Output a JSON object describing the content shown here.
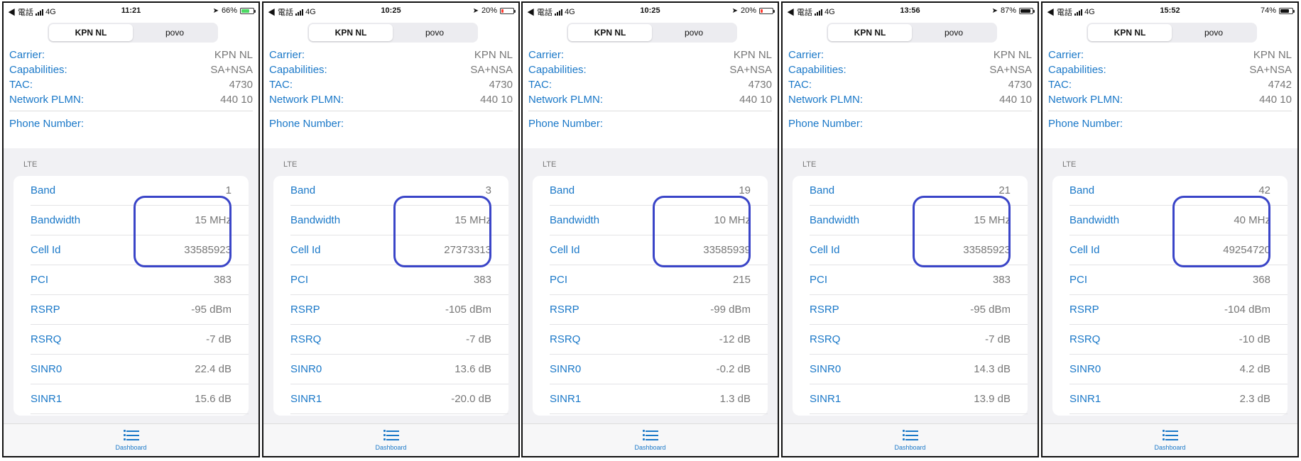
{
  "common": {
    "status_left": "◀ 電話",
    "network": "4G",
    "segments": [
      "KPN NL",
      "povo"
    ],
    "labels": {
      "carrier": "Carrier:",
      "capabilities": "Capabilities:",
      "tac": "TAC:",
      "plmn": "Network PLMN:",
      "phone": "Phone Number:",
      "section": "LTE",
      "band": "Band",
      "bandwidth": "Bandwidth",
      "cell_id": "Cell Id",
      "pci": "PCI",
      "rsrp": "RSRP",
      "rsrq": "RSRQ",
      "sinr0": "SINR0",
      "sinr1": "SINR1"
    },
    "tab_label": "Dashboard",
    "tab_icon": "list-icon",
    "accent": "#1a78c8",
    "highlight_color": "#3a45c8"
  },
  "phones": [
    {
      "time": "11:21",
      "location": true,
      "battery_text": "66%",
      "battery_level": 0.66,
      "battery_color": "#4cd964",
      "charging": true,
      "carrier": "KPN NL",
      "capabilities": "SA+NSA",
      "tac": "4730",
      "plmn": "440 10",
      "band": "1",
      "bandwidth": "15 MHz",
      "cell_id": "33585923",
      "pci": "383",
      "rsrp": "-95 dBm",
      "rsrq": "-7 dB",
      "sinr0": "22.4 dB",
      "sinr1": "15.6 dB"
    },
    {
      "time": "10:25",
      "location": true,
      "battery_text": "20%",
      "battery_level": 0.2,
      "battery_color": "#ff3b30",
      "charging": false,
      "carrier": "KPN NL",
      "capabilities": "SA+NSA",
      "tac": "4730",
      "plmn": "440 10",
      "band": "3",
      "bandwidth": "15 MHz",
      "cell_id": "27373313",
      "pci": "383",
      "rsrp": "-105 dBm",
      "rsrq": "-7 dB",
      "sinr0": "13.6 dB",
      "sinr1": "-20.0 dB"
    },
    {
      "time": "10:25",
      "location": true,
      "battery_text": "20%",
      "battery_level": 0.2,
      "battery_color": "#ff3b30",
      "charging": false,
      "carrier": "KPN NL",
      "capabilities": "SA+NSA",
      "tac": "4730",
      "plmn": "440 10",
      "band": "19",
      "bandwidth": "10 MHz",
      "cell_id": "33585939",
      "pci": "215",
      "rsrp": "-99 dBm",
      "rsrq": "-12 dB",
      "sinr0": "-0.2 dB",
      "sinr1": "1.3 dB"
    },
    {
      "time": "13:56",
      "location": true,
      "battery_text": "87%",
      "battery_level": 0.87,
      "battery_color": "#111111",
      "charging": false,
      "carrier": "KPN NL",
      "capabilities": "SA+NSA",
      "tac": "4730",
      "plmn": "440 10",
      "band": "21",
      "bandwidth": "15 MHz",
      "cell_id": "33585923",
      "pci": "383",
      "rsrp": "-95 dBm",
      "rsrq": "-7 dB",
      "sinr0": "14.3 dB",
      "sinr1": "13.9 dB"
    },
    {
      "time": "15:52",
      "location": false,
      "battery_text": "74%",
      "battery_level": 0.74,
      "battery_color": "#111111",
      "charging": false,
      "carrier": "KPN NL",
      "capabilities": "SA+NSA",
      "tac": "4742",
      "plmn": "440 10",
      "band": "42",
      "bandwidth": "40 MHz",
      "cell_id": "49254720",
      "pci": "368",
      "rsrp": "-104 dBm",
      "rsrq": "-10 dB",
      "sinr0": "4.2 dB",
      "sinr1": "2.3 dB"
    }
  ]
}
